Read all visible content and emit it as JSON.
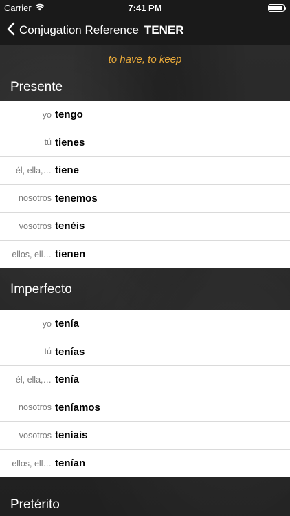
{
  "status_bar": {
    "carrier": "Carrier",
    "time": "7:41 PM",
    "battery_level": 0.95
  },
  "nav": {
    "back_label": "Conjugation Reference",
    "title": "TENER"
  },
  "translation": "to have, to keep",
  "sections": [
    {
      "title": "Presente",
      "rows": [
        {
          "pronoun": "yo",
          "verb": "tengo"
        },
        {
          "pronoun": "tú",
          "verb": "tienes"
        },
        {
          "pronoun": "él, ella,…",
          "verb": "tiene"
        },
        {
          "pronoun": "nosotros",
          "verb": "tenemos"
        },
        {
          "pronoun": "vosotros",
          "verb": "tenéis"
        },
        {
          "pronoun": "ellos, ell…",
          "verb": "tienen"
        }
      ]
    },
    {
      "title": "Imperfecto",
      "rows": [
        {
          "pronoun": "yo",
          "verb": "tenía"
        },
        {
          "pronoun": "tú",
          "verb": "tenías"
        },
        {
          "pronoun": "él, ella,…",
          "verb": "tenía"
        },
        {
          "pronoun": "nosotros",
          "verb": "teníamos"
        },
        {
          "pronoun": "vosotros",
          "verb": "teníais"
        },
        {
          "pronoun": "ellos, ell…",
          "verb": "tenían"
        }
      ]
    },
    {
      "title": "Pretérito",
      "rows": []
    }
  ],
  "icons": {
    "wifi": "wifi-icon",
    "battery": "battery-icon",
    "back": "chevron-left-icon"
  },
  "colors": {
    "accent_translation": "#e8a93a",
    "bar_background": "#1a1a1a"
  }
}
